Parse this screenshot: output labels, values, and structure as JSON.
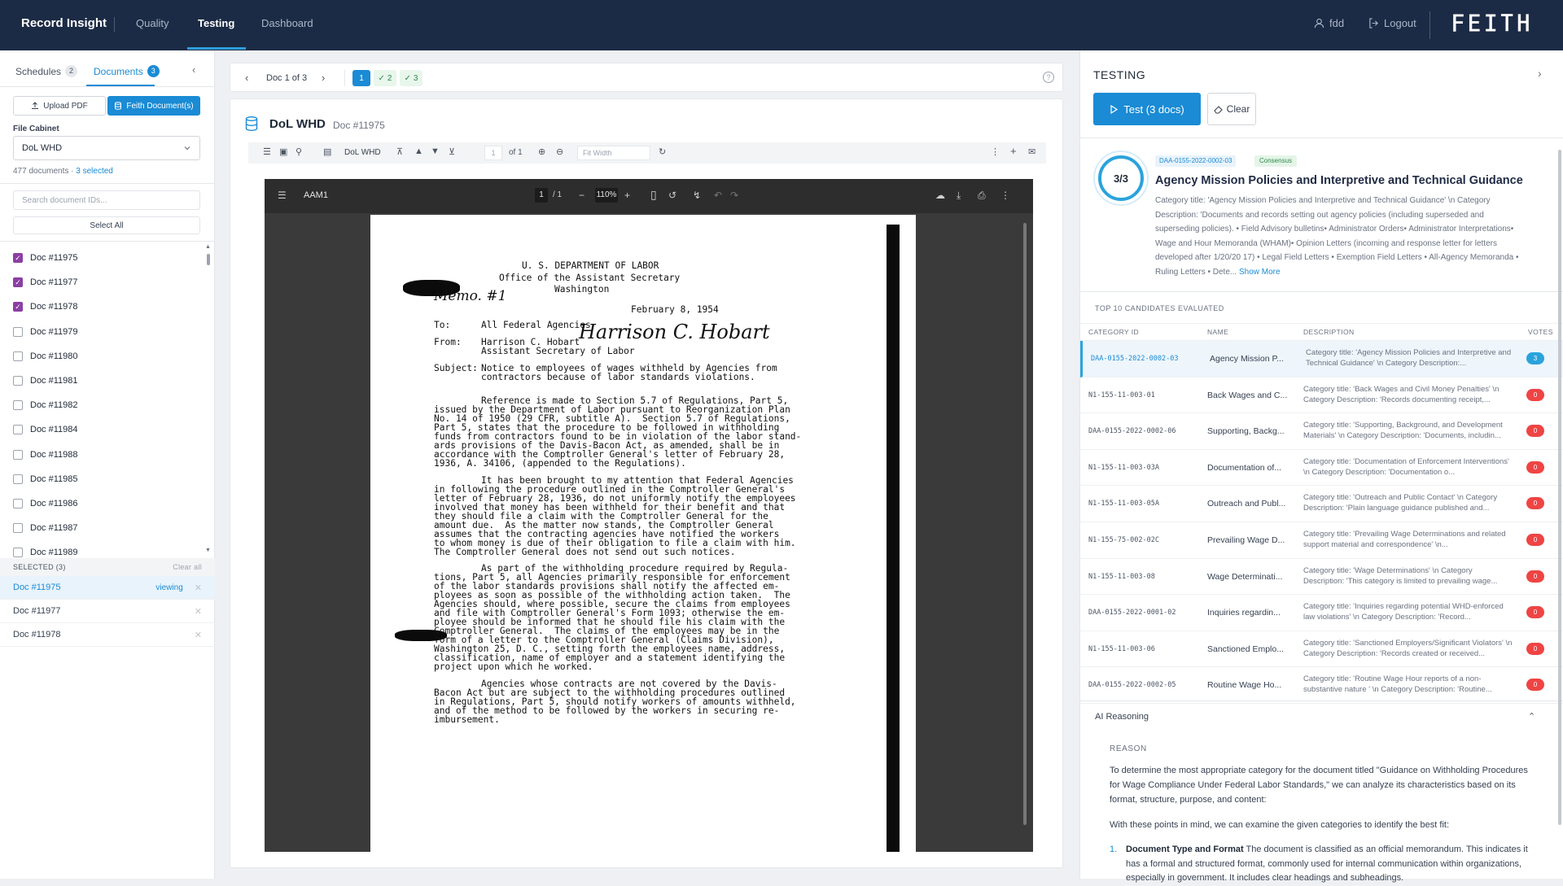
{
  "nav": {
    "brand": "Record Insight",
    "tabs": [
      {
        "label": "Quality",
        "active": false
      },
      {
        "label": "Testing",
        "active": true
      },
      {
        "label": "Dashboard",
        "active": false
      }
    ],
    "user": "fdd",
    "logout": "Logout",
    "logo": "FEITH"
  },
  "left": {
    "tabs": [
      {
        "label": "Schedules",
        "count": "2"
      },
      {
        "label": "Documents",
        "count": "3"
      }
    ],
    "upload_label": "Upload PDF",
    "feith_label": "Feith Document(s)",
    "file_cabinet_label": "File Cabinet",
    "file_cabinet_value": "DoL WHD",
    "doc_count": "477 documents",
    "selected_count": "3 selected",
    "search_placeholder": "Search document IDs...",
    "select_all": "Select All",
    "docs": [
      {
        "label": "Doc #11975",
        "checked": true
      },
      {
        "label": "Doc #11977",
        "checked": true
      },
      {
        "label": "Doc #11978",
        "checked": true
      },
      {
        "label": "Doc #11979",
        "checked": false
      },
      {
        "label": "Doc #11980",
        "checked": false
      },
      {
        "label": "Doc #11981",
        "checked": false
      },
      {
        "label": "Doc #11982",
        "checked": false
      },
      {
        "label": "Doc #11984",
        "checked": false
      },
      {
        "label": "Doc #11988",
        "checked": false
      },
      {
        "label": "Doc #11985",
        "checked": false
      },
      {
        "label": "Doc #11986",
        "checked": false
      },
      {
        "label": "Doc #11987",
        "checked": false
      },
      {
        "label": "Doc #11989",
        "checked": false
      }
    ],
    "selected_header": "SELECTED (3)",
    "clear_all": "Clear all",
    "selected": [
      {
        "label": "Doc #11975",
        "status": "viewing"
      },
      {
        "label": "Doc #11977",
        "status": ""
      },
      {
        "label": "Doc #11978",
        "status": ""
      }
    ]
  },
  "center": {
    "doc_position": "Doc 1 of 3",
    "pills": [
      "1",
      "2",
      "3"
    ],
    "viewer_title": "DoL WHD",
    "viewer_subtitle": "Doc #11975",
    "toolbar_title": "DoL WHD",
    "page_input": "1",
    "page_of": "of 1",
    "fit_placeholder": "Fit Width",
    "pdf": {
      "filename": "AAM1",
      "page": "1",
      "pages": "/  1",
      "zoom": "110%"
    },
    "letter": [
      "U. S. DEPARTMENT OF LABOR",
      "Office of the Assistant Secretary",
      "Washington",
      "February 8, 1954",
      "To:",
      "All Federal Agencies",
      "From:",
      "Harrison C. Hobart",
      "Assistant Secretary of Labor",
      "Subject:",
      "Notice to employees of wages withheld by Agencies from",
      "contractors because of labor standards violations.",
      "Reference is made to Section 5.7 of Regulations, Part 5,",
      "issued by the Department of Labor pursuant to Reorganization Plan",
      "No. 14 of 1950 (29 CFR, subtitle A).  Section 5.7 of Regulations,",
      "Part 5, states that the procedure to be followed in withholding",
      "funds from contractors found to be in violation of the labor stand-",
      "ards provisions of the Davis-Bacon Act, as amended, shall be in",
      "accordance with the Comptroller General's letter of February 28,",
      "1936, A. 34106, (appended to the Regulations).",
      "It has been brought to my attention that Federal Agencies",
      "in following the procedure outlined in the Comptroller General's",
      "letter of February 28, 1936, do not uniformly notify the employees",
      "involved that money has been withheld for their benefit and that",
      "they should file a claim with the Comptroller General for the",
      "amount due.  As the matter now stands, the Comptroller General",
      "assumes that the contracting agencies have notified the workers",
      "to whom money is due of their obligation to file a claim with him.",
      "The Comptroller General does not send out such notices.",
      "As part of the withholding procedure required by Regula-",
      "tions, Part 5, all Agencies primarily responsible for enforcement",
      "of the labor standards provisions shall notify the affected em-",
      "ployees as soon as possible of the withholding action taken.  The",
      "Agencies should, where possible, secure the claims from employees",
      "and file with Comptroller General's Form 1093; otherwise the em-",
      "ployee should be informed that he should file his claim with the",
      "Comptroller General.  The claims of the employees may be in the",
      "form of a letter to the Comptroller General (Claims Division),",
      "Washington 25, D. C., setting forth the employees name, address,",
      "classification, name of employer and a statement identifying the",
      "project upon which he worked.",
      "Agencies whose contracts are not covered by the Davis-",
      "Bacon Act but are subject to the withholding procedures outlined",
      "in Regulations, Part 5, should notify workers of amounts withheld,",
      "and of the method to be followed by the workers in securing re-",
      "imbursement."
    ],
    "handwriting": {
      "memo": "Memo. #1",
      "signature": "Harrison C. Hobart"
    }
  },
  "right": {
    "title": "TESTING",
    "test_button": "Test (3 docs)",
    "clear_button": "Clear",
    "score": "3/3",
    "best_id": "DAA-0155-2022-0002-03",
    "consensus": "Consensus",
    "best_name": "Agency Mission Policies and Interpretive and Technical Guidance",
    "best_desc": "Category title: 'Agency Mission Policies and Interpretive and Technical Guidance' \\n Category Description: 'Documents and records setting out agency policies (including superseded and superseding policies). • Field Advisory bulletins• Administrator Orders• Administrator Interpretations• Wage and Hour Memoranda (WHAM)• Opinion Letters (incoming and response letter for letters developed after 1/20/20 17) • Legal Field Letters • Exemption Field Letters • All-Agency Memoranda • Ruling Letters • Dete...",
    "show_more": "Show More",
    "top10_label": "TOP 10 CANDIDATES EVALUATED",
    "columns": [
      "CATEGORY ID",
      "NAME",
      "DESCRIPTION",
      "VOTES"
    ],
    "candidates": [
      {
        "id": "DAA-0155-2022-0002-03",
        "name": "Agency Mission P...",
        "desc": "Category title: 'Agency Mission Policies and Interpretive and Technical Guidance' \\n Category Description:...",
        "votes": "3"
      },
      {
        "id": "N1-155-11-003-01",
        "name": "Back Wages and C...",
        "desc": "Category title: 'Back Wages and Civil Money Penalties' \\n Category Description: 'Records documenting receipt,...",
        "votes": "0"
      },
      {
        "id": "DAA-0155-2022-0002-06",
        "name": "Supporting, Backg...",
        "desc": "Category title: 'Supporting, Background, and Development Materials' \\n Category Description: 'Documents, includin...",
        "votes": "0"
      },
      {
        "id": "N1-155-11-003-03A",
        "name": "Documentation of...",
        "desc": "Category title: 'Documentation of Enforcement Interventions' \\n Category Description: 'Documentation o...",
        "votes": "0"
      },
      {
        "id": "N1-155-11-003-05A",
        "name": "Outreach and Publ...",
        "desc": "Category title: 'Outreach and Public Contact' \\n Category Description: 'Plain language guidance published and...",
        "votes": "0"
      },
      {
        "id": "N1-155-75-002-02C",
        "name": "Prevailing Wage D...",
        "desc": "Category title: 'Prevailing Wage Determinations and related support material and correspondence' \\n...",
        "votes": "0"
      },
      {
        "id": "N1-155-11-003-08",
        "name": "Wage Determinati...",
        "desc": "Category title: 'Wage Determinations' \\n Category Description: 'This category is limited to prevailing wage...",
        "votes": "0"
      },
      {
        "id": "DAA-0155-2022-0001-02",
        "name": "Inquiries regardin...",
        "desc": "Category title: 'Inquiries regarding potential WHD-enforced law violations' \\n Category Description: 'Record...",
        "votes": "0"
      },
      {
        "id": "N1-155-11-003-06",
        "name": "Sanctioned Emplo...",
        "desc": "Category title: 'Sanctioned Employers/Significant Violators' \\n Category Description: 'Records created or received...",
        "votes": "0"
      },
      {
        "id": "DAA-0155-2022-0002-05",
        "name": "Routine Wage Ho...",
        "desc": "Category title: 'Routine Wage Hour reports of a non-substantive nature ' \\n Category Description: 'Routine...",
        "votes": "0"
      }
    ],
    "ai_reasoning": "AI Reasoning",
    "reason_label": "REASON",
    "reason_p1": "To determine the most appropriate category for the document titled \"Guidance on Withholding Procedures for Wage Compliance Under Federal Labor Standards,\" we can analyze its characteristics based on its format, structure, purpose, and content:",
    "reason_p2": "With these points in mind, we can examine the given categories to identify the best fit:",
    "reason_item_num": "1.",
    "reason_item_title": "Document Type and Format",
    "reason_item_text": " The document is classified as an official memorandum. This indicates it has a formal and structured format, commonly used for internal communication within organizations, especially in government. It includes clear headings and subheadings."
  },
  "colors": {
    "nav_bg": "#1c2b45",
    "accent": "#1a8bd4",
    "check": "#8b3fa3",
    "vote_zero": "#ef4444"
  }
}
